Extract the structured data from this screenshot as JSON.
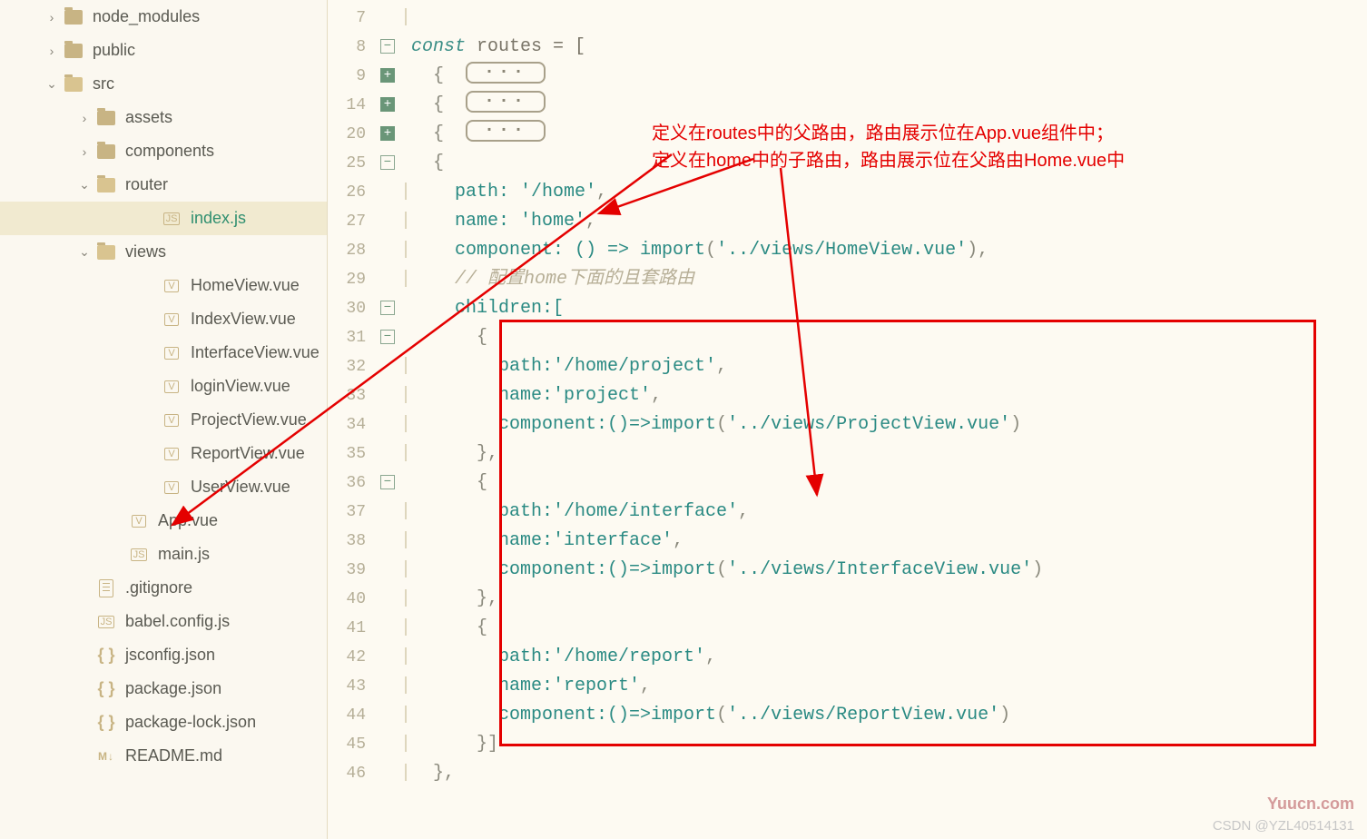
{
  "sidebar": {
    "items": [
      {
        "indent": 50,
        "chev": "›",
        "iconType": "folder-closed",
        "label": "node_modules",
        "name": "tree-node-modules"
      },
      {
        "indent": 50,
        "chev": "›",
        "iconType": "folder-closed",
        "label": "public",
        "name": "tree-public"
      },
      {
        "indent": 50,
        "chev": "v",
        "iconType": "folder-open",
        "label": "src",
        "name": "tree-src"
      },
      {
        "indent": 86,
        "chev": "›",
        "iconType": "folder-closed",
        "label": "assets",
        "name": "tree-assets"
      },
      {
        "indent": 86,
        "chev": "›",
        "iconType": "folder-closed",
        "label": "components",
        "name": "tree-components"
      },
      {
        "indent": 86,
        "chev": "v",
        "iconType": "folder-open",
        "label": "router",
        "name": "tree-router"
      },
      {
        "indent": 158,
        "chev": "",
        "iconType": "js",
        "label": "index.js",
        "name": "tree-index-js",
        "selected": true
      },
      {
        "indent": 86,
        "chev": "v",
        "iconType": "folder-open",
        "label": "views",
        "name": "tree-views"
      },
      {
        "indent": 158,
        "chev": "",
        "iconType": "vue",
        "label": "HomeView.vue",
        "name": "tree-homeview"
      },
      {
        "indent": 158,
        "chev": "",
        "iconType": "vue",
        "label": "IndexView.vue",
        "name": "tree-indexview"
      },
      {
        "indent": 158,
        "chev": "",
        "iconType": "vue",
        "label": "InterfaceView.vue",
        "name": "tree-interfaceview"
      },
      {
        "indent": 158,
        "chev": "",
        "iconType": "vue",
        "label": "loginView.vue",
        "name": "tree-loginview"
      },
      {
        "indent": 158,
        "chev": "",
        "iconType": "vue",
        "label": "ProjectView.vue",
        "name": "tree-projectview"
      },
      {
        "indent": 158,
        "chev": "",
        "iconType": "vue",
        "label": "ReportView.vue",
        "name": "tree-reportview"
      },
      {
        "indent": 158,
        "chev": "",
        "iconType": "vue",
        "label": "UserView.vue",
        "name": "tree-userview"
      },
      {
        "indent": 122,
        "chev": "",
        "iconType": "vue",
        "label": "App.vue",
        "name": "tree-appvue"
      },
      {
        "indent": 122,
        "chev": "",
        "iconType": "js",
        "label": "main.js",
        "name": "tree-mainjs"
      },
      {
        "indent": 86,
        "chev": "",
        "iconType": "generic",
        "label": ".gitignore",
        "name": "tree-gitignore"
      },
      {
        "indent": 86,
        "chev": "",
        "iconType": "js",
        "label": "babel.config.js",
        "name": "tree-babel"
      },
      {
        "indent": 86,
        "chev": "",
        "iconType": "brackets",
        "label": "jsconfig.json",
        "name": "tree-jsconfig"
      },
      {
        "indent": 86,
        "chev": "",
        "iconType": "brackets",
        "label": "package.json",
        "name": "tree-package"
      },
      {
        "indent": 86,
        "chev": "",
        "iconType": "brackets",
        "label": "package-lock.json",
        "name": "tree-packagelock"
      },
      {
        "indent": 86,
        "chev": "",
        "iconType": "md",
        "label": "README.md",
        "name": "tree-readme"
      }
    ]
  },
  "editor": {
    "lines": [
      {
        "num": "7",
        "fold": "",
        "guide": "|",
        "tokens": []
      },
      {
        "num": "8",
        "fold": "minus",
        "guide": "",
        "tokens": [
          {
            "t": "const ",
            "c": "kw"
          },
          {
            "t": "routes = [",
            "c": "plain"
          }
        ]
      },
      {
        "num": "9",
        "fold": "plus",
        "guide": "",
        "tokens": [
          {
            "t": "  {  ",
            "c": "punct"
          },
          {
            "t": "PILL",
            "c": "pill"
          }
        ]
      },
      {
        "num": "14",
        "fold": "plus",
        "guide": "",
        "tokens": [
          {
            "t": "  {  ",
            "c": "punct"
          },
          {
            "t": "PILL",
            "c": "pill"
          }
        ]
      },
      {
        "num": "20",
        "fold": "plus",
        "guide": "",
        "tokens": [
          {
            "t": "  {  ",
            "c": "punct"
          },
          {
            "t": "PILL",
            "c": "pill"
          }
        ]
      },
      {
        "num": "25",
        "fold": "minus",
        "guide": "",
        "tokens": [
          {
            "t": "  {",
            "c": "punct"
          }
        ]
      },
      {
        "num": "26",
        "fold": "",
        "guide": "|",
        "tokens": [
          {
            "t": "    path: ",
            "c": "prop"
          },
          {
            "t": "'/home'",
            "c": "str"
          },
          {
            "t": ",",
            "c": "punct"
          }
        ]
      },
      {
        "num": "27",
        "fold": "",
        "guide": "|",
        "tokens": [
          {
            "t": "    name: ",
            "c": "prop"
          },
          {
            "t": "'home'",
            "c": "str"
          },
          {
            "t": ",",
            "c": "punct"
          }
        ]
      },
      {
        "num": "28",
        "fold": "",
        "guide": "|",
        "tokens": [
          {
            "t": "    component: () => ",
            "c": "prop"
          },
          {
            "t": "import",
            "c": "func"
          },
          {
            "t": "(",
            "c": "punct"
          },
          {
            "t": "'../views/HomeView.vue'",
            "c": "str"
          },
          {
            "t": "),",
            "c": "punct"
          }
        ]
      },
      {
        "num": "29",
        "fold": "",
        "guide": "|",
        "tokens": [
          {
            "t": "    // 配置home下面的且套路由",
            "c": "comment"
          }
        ]
      },
      {
        "num": "30",
        "fold": "minus",
        "guide": "",
        "tokens": [
          {
            "t": "    children:[",
            "c": "prop"
          }
        ]
      },
      {
        "num": "31",
        "fold": "minus",
        "guide": "",
        "tokens": [
          {
            "t": "      {",
            "c": "punct"
          }
        ]
      },
      {
        "num": "32",
        "fold": "",
        "guide": "|",
        "tokens": [
          {
            "t": "        path:",
            "c": "prop"
          },
          {
            "t": "'/home/project'",
            "c": "str"
          },
          {
            "t": ",",
            "c": "punct"
          }
        ]
      },
      {
        "num": "33",
        "fold": "",
        "guide": "|",
        "tokens": [
          {
            "t": "        name:",
            "c": "prop"
          },
          {
            "t": "'project'",
            "c": "str"
          },
          {
            "t": ",",
            "c": "punct"
          }
        ]
      },
      {
        "num": "34",
        "fold": "",
        "guide": "|",
        "tokens": [
          {
            "t": "        component:()=>",
            "c": "prop"
          },
          {
            "t": "import",
            "c": "func"
          },
          {
            "t": "(",
            "c": "punct"
          },
          {
            "t": "'../views/ProjectView.vue'",
            "c": "str"
          },
          {
            "t": ")",
            "c": "punct"
          }
        ]
      },
      {
        "num": "35",
        "fold": "",
        "guide": "|",
        "tokens": [
          {
            "t": "      },",
            "c": "punct"
          }
        ]
      },
      {
        "num": "36",
        "fold": "minus",
        "guide": "",
        "tokens": [
          {
            "t": "      {",
            "c": "punct"
          }
        ]
      },
      {
        "num": "37",
        "fold": "",
        "guide": "|",
        "tokens": [
          {
            "t": "        path:",
            "c": "prop"
          },
          {
            "t": "'/home/interface'",
            "c": "str"
          },
          {
            "t": ",",
            "c": "punct"
          }
        ]
      },
      {
        "num": "38",
        "fold": "",
        "guide": "|",
        "tokens": [
          {
            "t": "        name:",
            "c": "prop"
          },
          {
            "t": "'interface'",
            "c": "str"
          },
          {
            "t": ",",
            "c": "punct"
          }
        ]
      },
      {
        "num": "39",
        "fold": "",
        "guide": "|",
        "tokens": [
          {
            "t": "        component:()=>",
            "c": "prop"
          },
          {
            "t": "import",
            "c": "func"
          },
          {
            "t": "(",
            "c": "punct"
          },
          {
            "t": "'../views/InterfaceView.vue'",
            "c": "str"
          },
          {
            "t": ")",
            "c": "punct"
          }
        ]
      },
      {
        "num": "40",
        "fold": "",
        "guide": "|",
        "tokens": [
          {
            "t": "      },",
            "c": "punct"
          }
        ]
      },
      {
        "num": "41",
        "fold": "",
        "guide": "|",
        "tokens": [
          {
            "t": "      {",
            "c": "punct"
          }
        ]
      },
      {
        "num": "42",
        "fold": "",
        "guide": "|",
        "tokens": [
          {
            "t": "        path:",
            "c": "prop"
          },
          {
            "t": "'/home/report'",
            "c": "str"
          },
          {
            "t": ",",
            "c": "punct"
          }
        ]
      },
      {
        "num": "43",
        "fold": "",
        "guide": "|",
        "tokens": [
          {
            "t": "        name:",
            "c": "prop"
          },
          {
            "t": "'report'",
            "c": "str"
          },
          {
            "t": ",",
            "c": "punct"
          }
        ]
      },
      {
        "num": "44",
        "fold": "",
        "guide": "|",
        "tokens": [
          {
            "t": "        component:()=>",
            "c": "prop"
          },
          {
            "t": "import",
            "c": "func"
          },
          {
            "t": "(",
            "c": "punct"
          },
          {
            "t": "'../views/ReportView.vue'",
            "c": "str"
          },
          {
            "t": ")",
            "c": "punct"
          }
        ]
      },
      {
        "num": "45",
        "fold": "",
        "guide": "|",
        "tokens": [
          {
            "t": "      }]",
            "c": "punct"
          }
        ]
      },
      {
        "num": "46",
        "fold": "",
        "guide": "|",
        "tokens": [
          {
            "t": "  },",
            "c": "punct"
          }
        ]
      }
    ]
  },
  "annotations": {
    "line1": "定义在routes中的父路由，路由展示位在App.vue组件中；",
    "line2": "定义在home中的子路由，路由展示位在父路由Home.vue中"
  },
  "watermark": {
    "site": "Yuucn.com",
    "csdn": "CSDN @YZL40514131"
  }
}
